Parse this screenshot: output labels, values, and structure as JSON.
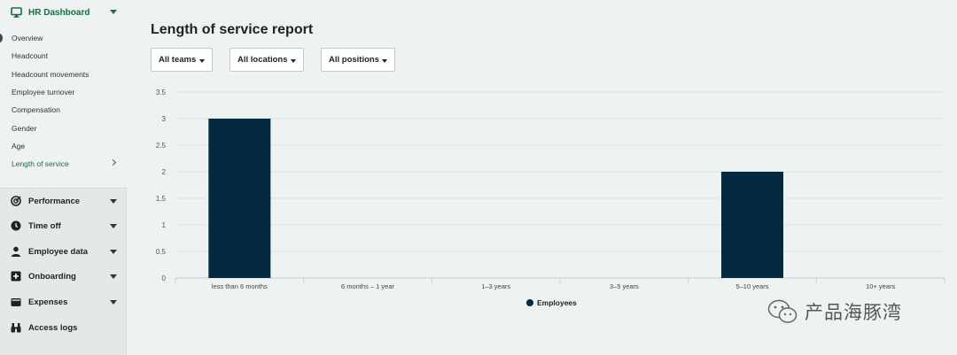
{
  "sidebar": {
    "header": {
      "label": "HR Dashboard",
      "icon": "monitor-icon"
    },
    "sub_items": [
      {
        "label": "Overview"
      },
      {
        "label": "Headcount"
      },
      {
        "label": "Headcount movements"
      },
      {
        "label": "Employee turnover"
      },
      {
        "label": "Compensation"
      },
      {
        "label": "Gender"
      },
      {
        "label": "Age"
      },
      {
        "label": "Length of service",
        "active": true
      }
    ],
    "nav_items": [
      {
        "label": "Performance",
        "icon": "target-icon"
      },
      {
        "label": "Time off",
        "icon": "clock-icon"
      },
      {
        "label": "Employee data",
        "icon": "person-icon"
      },
      {
        "label": "Onboarding",
        "icon": "plus-box-icon"
      },
      {
        "label": "Expenses",
        "icon": "wallet-icon"
      },
      {
        "label": "Access logs",
        "icon": "binoculars-icon"
      }
    ]
  },
  "main": {
    "title": "Length of service report",
    "filters": [
      {
        "label": "All teams"
      },
      {
        "label": "All locations"
      },
      {
        "label": "All positions"
      }
    ]
  },
  "chart_data": {
    "type": "bar",
    "categories": [
      "less than 6 months",
      "6 months – 1 year",
      "1–3 years",
      "3–5 years",
      "5–10 years",
      "10+ years"
    ],
    "series": [
      {
        "name": "Employees",
        "values": [
          3,
          0,
          0,
          0,
          2,
          0
        ]
      }
    ],
    "ylim": [
      0,
      3.5
    ],
    "yticks": [
      "0",
      "0.5",
      "1",
      "1.5",
      "2",
      "2.5",
      "3",
      "3.5"
    ],
    "grid": true,
    "legend": "bottom-center",
    "bar_color": "#032a3e"
  },
  "watermark": {
    "text": "产品海豚湾"
  }
}
